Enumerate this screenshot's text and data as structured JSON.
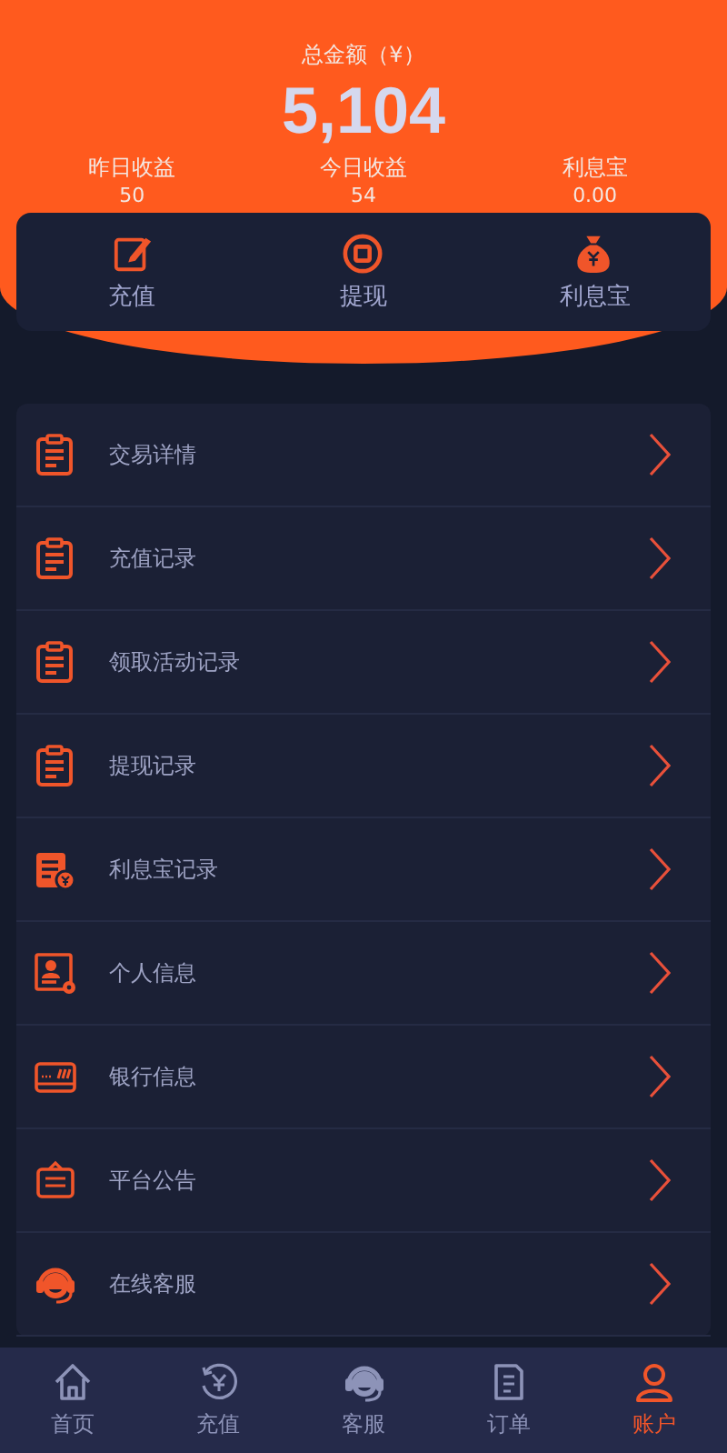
{
  "summary": {
    "title": "总金额（¥）",
    "amount": "5,104",
    "stats": [
      {
        "label": "昨日收益",
        "value": "50"
      },
      {
        "label": "今日收益",
        "value": "54"
      },
      {
        "label": "利息宝",
        "value": "0.00"
      }
    ]
  },
  "quick_actions": [
    {
      "kind": "edit",
      "label": "充值"
    },
    {
      "kind": "coin",
      "label": "提现"
    },
    {
      "kind": "bag",
      "label": "利息宝"
    }
  ],
  "menu": [
    {
      "kind": "clipboard",
      "label": "交易详情"
    },
    {
      "kind": "clipboard",
      "label": "充值记录"
    },
    {
      "kind": "clipboard",
      "label": "领取活动记录"
    },
    {
      "kind": "clipboard",
      "label": "提现记录"
    },
    {
      "kind": "receipt",
      "label": "利息宝记录"
    },
    {
      "kind": "profile",
      "label": "个人信息"
    },
    {
      "kind": "card",
      "label": "银行信息"
    },
    {
      "kind": "notice",
      "label": "平台公告"
    },
    {
      "kind": "headset",
      "label": "在线客服"
    }
  ],
  "bottom_nav": [
    {
      "kind": "home",
      "label": "首页",
      "selected": false
    },
    {
      "kind": "yen",
      "label": "充值",
      "selected": false
    },
    {
      "kind": "headset",
      "label": "客服",
      "selected": false
    },
    {
      "kind": "doc",
      "label": "订单",
      "selected": false
    },
    {
      "kind": "person",
      "label": "账户",
      "selected": true
    }
  ]
}
